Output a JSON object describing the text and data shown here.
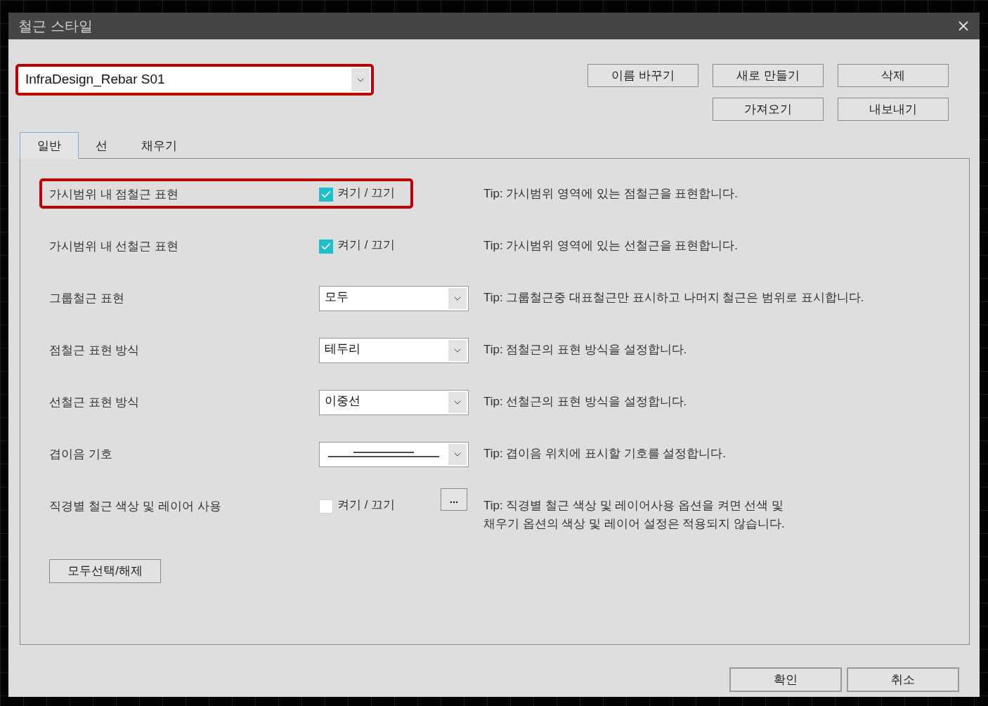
{
  "window": {
    "title": "철근 스타일"
  },
  "style_select": {
    "value": "InfraDesign_Rebar S01",
    "highlighted": true
  },
  "top_buttons": [
    [
      "이름 바꾸기",
      "새로 만들기",
      "삭제"
    ],
    [
      "가져오기",
      "내보내기"
    ]
  ],
  "tabs": [
    {
      "label": "일반",
      "selected": true
    },
    {
      "label": "선",
      "selected": false
    },
    {
      "label": "채우기",
      "selected": false
    }
  ],
  "rows": [
    {
      "kind": "checkbox",
      "label": "가시범위 내 점철근 표현",
      "checked": true,
      "option_label": "켜기 / 끄기",
      "highlighted": true,
      "tip": [
        "Tip: 가시범위 영역에 있는 점철근을 표현합니다."
      ]
    },
    {
      "kind": "checkbox",
      "label": "가시범위 내 선철근 표현",
      "checked": true,
      "option_label": "켜기 / 끄기",
      "highlighted": false,
      "tip": [
        "Tip: 가시범위 영역에 있는 선철근을 표현합니다."
      ]
    },
    {
      "kind": "select",
      "label": "그룹철근 표현",
      "value": "모두",
      "highlighted": false,
      "tip": [
        "Tip: 그룹철근중 대표철근만 표시하고 나머지 철근은 범위로 표시합니다."
      ]
    },
    {
      "kind": "select",
      "label": "점철근 표현 방식",
      "value": "테두리",
      "highlighted": false,
      "tip": [
        "Tip: 점철근의 표현 방식을 설정합니다."
      ]
    },
    {
      "kind": "select",
      "label": "선철근 표현 방식",
      "value": "이중선",
      "highlighted": false,
      "tip": [
        "Tip: 선철근의 표현 방식을 설정합니다."
      ]
    },
    {
      "kind": "symbol-select",
      "label": "겹이음 기호",
      "highlighted": false,
      "tip": [
        "Tip: 겹이음 위치에 표시할 기호를 설정합니다."
      ]
    },
    {
      "kind": "checkbox-more",
      "label": "직경별 철근 색상 및 레이어 사용",
      "checked": false,
      "option_label": "켜기 / 끄기",
      "more": "...",
      "highlighted": false,
      "tip": [
        "Tip: 직경별 철근 색상 및 레이어사용 옵션을 켜면 선색 및",
        "채우기 옵션의 색상 및 레이어 설정은 적용되지 않습니다."
      ]
    }
  ],
  "select_all_button": "모두선택/해제",
  "footer_buttons": [
    "확인",
    "취소"
  ]
}
